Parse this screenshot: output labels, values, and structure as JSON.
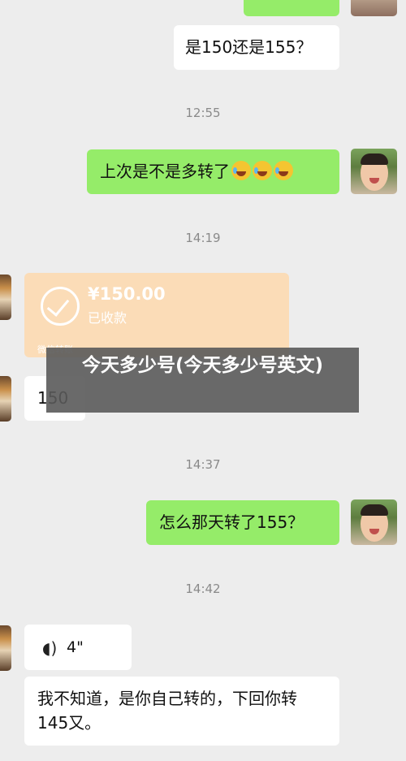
{
  "messages": {
    "m1": "是150还是155？",
    "t1": "12:55",
    "m2": "上次是不是多转了",
    "t2": "14:19",
    "transfer": {
      "amount": "¥150.00",
      "status": "已收款",
      "footer": "微信转账"
    },
    "overlay_title": "今天多少号(今天多少号英文)",
    "m3": "150",
    "t3": "14:37",
    "m4": "怎么那天转了155？",
    "t4": "14:42",
    "voice": {
      "duration": "4\""
    },
    "m5": "我不知道，是你自己转的，下回你转145又。"
  },
  "icons": {
    "emoji": "face-with-tears-of-joy-icon",
    "voice": "voice-wave-icon",
    "check": "checkmark-circle-icon"
  },
  "colors": {
    "green_bubble": "#95ec69",
    "transfer": "#fbdcb7",
    "background": "#ededed"
  }
}
